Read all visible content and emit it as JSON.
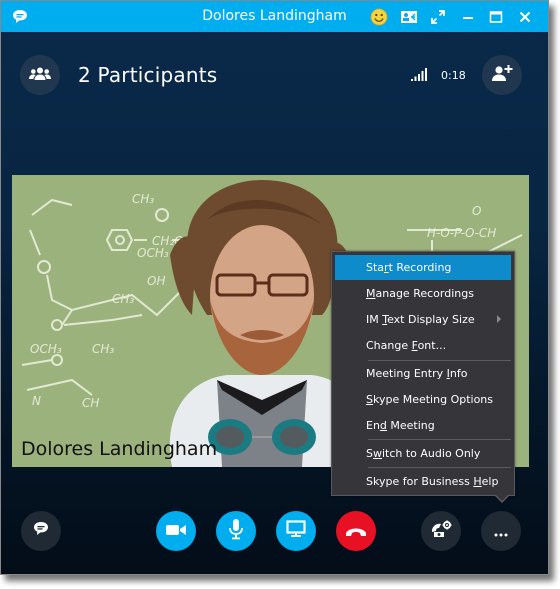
{
  "window": {
    "title": "Dolores Landingham",
    "app_icon": "chat-bubble-icon",
    "title_buttons": [
      "emoticon-icon",
      "contact-card-icon",
      "full-screen-icon",
      "minimize-icon",
      "maximize-icon",
      "close-icon"
    ]
  },
  "header": {
    "participants_icon": "participants-icon",
    "participants_label": "2 Participants",
    "signal_icon": "signal-strength-icon",
    "call_duration": "0:18",
    "add_participant_icon": "add-person-icon"
  },
  "video": {
    "participant_name": "Dolores Landingham"
  },
  "menu": {
    "items": [
      {
        "pre": "Sta",
        "accel": "r",
        "post": "t Recording",
        "active": true
      },
      {
        "pre": "",
        "accel": "M",
        "post": "anage Recordings"
      },
      {
        "pre": "IM ",
        "accel": "T",
        "post": "ext Display Size",
        "submenu": true
      },
      {
        "pre": "Change ",
        "accel": "F",
        "post": "ont..."
      },
      {
        "pre": "Meeting Entry ",
        "accel": "I",
        "post": "nfo"
      },
      {
        "pre": "",
        "accel": "S",
        "post": "kype Meeting Options"
      },
      {
        "pre": "En",
        "accel": "d",
        "post": " Meeting"
      },
      {
        "pre": "S",
        "accel": "w",
        "post": "itch to Audio Only"
      },
      {
        "pre": "Skype for Business ",
        "accel": "H",
        "post": "elp"
      }
    ]
  },
  "controls": {
    "im": "im-chat-icon",
    "video": "video-camera-icon",
    "mic": "microphone-icon",
    "share": "present-screen-icon",
    "hangup": "hang-up-icon",
    "call_controls": "call-controls-icon",
    "more": "more-options-icon"
  },
  "colors": {
    "accent": "#00adef",
    "hangup": "#e81123",
    "menu_highlight": "#0e8bca",
    "menu_bg": "#35353a",
    "background": "#082541"
  }
}
